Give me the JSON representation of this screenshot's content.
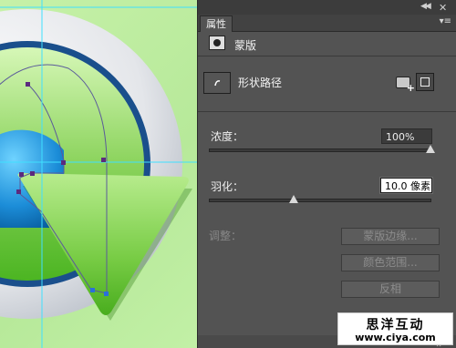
{
  "canvas": {
    "guide_color": "#3fe0ff",
    "path_color": "#5a5a9a",
    "anchor_color": "#5b2a7e"
  },
  "panel": {
    "tab_label": "属性",
    "menu_icon": "panel-menu-icon",
    "section_title": "蒙版",
    "shape_label": "形状路径",
    "density": {
      "label": "浓度：",
      "value": "100%",
      "level_percent": 100
    },
    "feather": {
      "label": "羽化：",
      "value": "10.0 像素",
      "level_fraction": 0.38
    },
    "adjust": {
      "label": "调整：",
      "buttons": [
        "蒙版边缘...",
        "颜色范围...",
        "反相"
      ]
    }
  },
  "watermark": {
    "title": "思洋互动",
    "url": "www.ciya.com"
  }
}
